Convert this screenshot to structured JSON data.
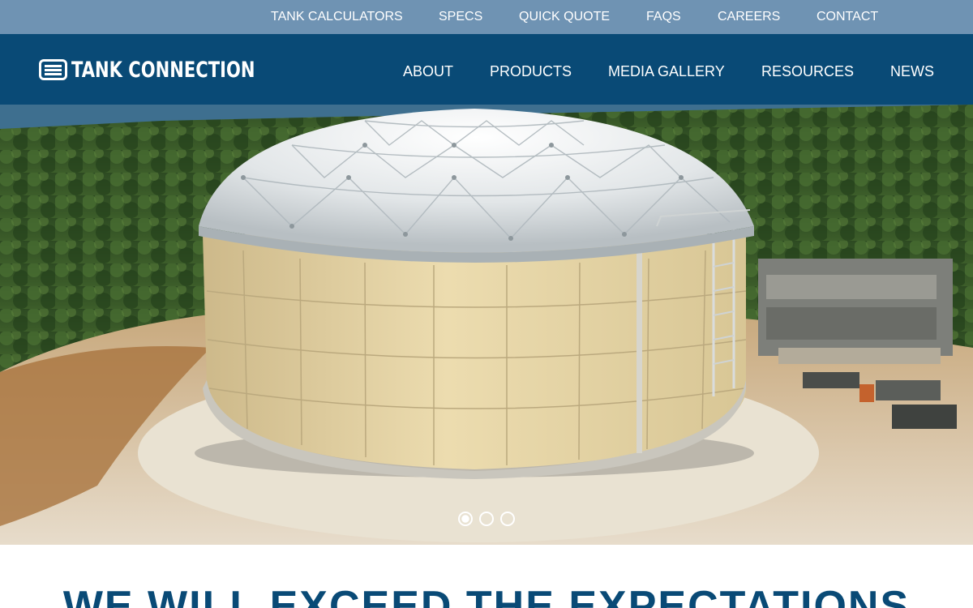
{
  "top_nav": [
    {
      "label": "TANK CALCULATORS"
    },
    {
      "label": "SPECS"
    },
    {
      "label": "QUICK QUOTE"
    },
    {
      "label": "FAQS"
    },
    {
      "label": "CAREERS"
    },
    {
      "label": "CONTACT"
    }
  ],
  "brand": {
    "name": "TANK CONNECTION",
    "icon": "tank-logo-icon"
  },
  "main_nav": [
    {
      "label": "ABOUT"
    },
    {
      "label": "PRODUCTS"
    },
    {
      "label": "MEDIA GALLERY"
    },
    {
      "label": "RESOURCES"
    },
    {
      "label": "NEWS"
    }
  ],
  "hero": {
    "slides_total": 3,
    "active_slide": 1
  },
  "headline": "WE WILL EXCEED THE EXPECTATIONS",
  "colors": {
    "topbar": "#6f93b3",
    "header": "#094a76",
    "headline": "#094a76"
  }
}
